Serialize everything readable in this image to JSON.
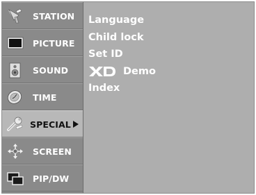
{
  "sidebar": {
    "items": [
      {
        "label": "STATION",
        "icon": "satellite-dish-icon",
        "selected": false
      },
      {
        "label": "PICTURE",
        "icon": "tv-screen-icon",
        "selected": false
      },
      {
        "label": "SOUND",
        "icon": "speaker-icon",
        "selected": false
      },
      {
        "label": "TIME",
        "icon": "clock-icon",
        "selected": false
      },
      {
        "label": "SPECIAL",
        "icon": "wrench-key-icon",
        "selected": true
      },
      {
        "label": "SCREEN",
        "icon": "move-arrows-icon",
        "selected": false
      },
      {
        "label": "PIP/DW",
        "icon": "pip-windows-icon",
        "selected": false
      }
    ]
  },
  "panel": {
    "options": [
      {
        "label": "Language"
      },
      {
        "label": "Child lock"
      },
      {
        "label": "Set ID"
      },
      {
        "label": "Demo",
        "logo_text": "XD"
      },
      {
        "label": "Index"
      }
    ]
  },
  "colors": {
    "menu_background": "#aeaeae",
    "sidebar_background": "#8a8a8a",
    "selected_background": "#b8b8b8",
    "text": "#ffffff",
    "selected_text": "#111111"
  }
}
